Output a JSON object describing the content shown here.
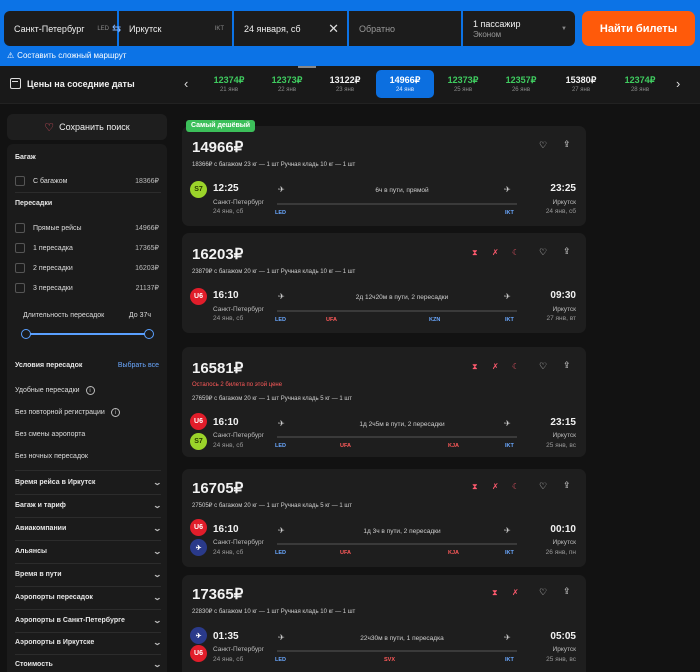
{
  "search": {
    "from": "Санкт-Петербург",
    "from_code": "LED",
    "to": "Иркутск",
    "to_code": "IKT",
    "date": "24 января, сб",
    "return_placeholder": "Обратно",
    "passengers": "1 пассажир",
    "cabin": "Эконом",
    "find_button": "Найти билеты",
    "complex_route": "Составить сложный маршрут"
  },
  "dates": {
    "title": "Цены на соседние даты",
    "cells": [
      {
        "price": "12374₽",
        "day": "21 янв",
        "style": "green"
      },
      {
        "price": "12373₽",
        "day": "22 янв",
        "style": "green"
      },
      {
        "price": "13122₽",
        "day": "23 янв",
        "style": "white"
      },
      {
        "price": "14966₽",
        "day": "24 янв",
        "style": "active"
      },
      {
        "price": "12373₽",
        "day": "25 янв",
        "style": "green"
      },
      {
        "price": "12357₽",
        "day": "26 янв",
        "style": "green"
      },
      {
        "price": "15380₽",
        "day": "27 янв",
        "style": "white"
      },
      {
        "price": "12374₽",
        "day": "28 янв",
        "style": "green"
      }
    ]
  },
  "sidebar": {
    "save_search": "Сохранить поиск",
    "baggage_title": "Багаж",
    "baggage_option": "С багажом",
    "baggage_value": "18366₽",
    "transfers_title": "Пересадки",
    "transfers": [
      {
        "label": "Прямые рейсы",
        "value": "14966₽"
      },
      {
        "label": "1 пересадка",
        "value": "17365₽"
      },
      {
        "label": "2 пересадки",
        "value": "16203₽"
      },
      {
        "label": "3 пересадки",
        "value": "21137₽"
      }
    ],
    "duration_label": "Длительность пересадок",
    "duration_value": "До 37ч",
    "conditions_title": "Условия пересадок",
    "select_all": "Выбрать все",
    "conditions": [
      "Удобные пересадки",
      "Без повторной регистрации",
      "Без смены аэропорта",
      "Без ночных пересадок"
    ],
    "accordions": [
      "Время рейса в Иркутск",
      "Багаж и тариф",
      "Авиакомпании",
      "Альянсы",
      "Время в пути",
      "Аэропорты пересадок",
      "Аэропорты в Санкт-Петербурге",
      "Аэропорты в Иркутске",
      "Стоимость"
    ]
  },
  "badge": "Самый дешёвый",
  "tickets": [
    {
      "price": "14966₽",
      "bag_line": "18366₽ с багажом 23 кг — 1 шт     Ручная кладь 10 кг — 1 шт",
      "dep_time": "12:25",
      "arr_time": "23:25",
      "dep_city": "Санкт-Петербург",
      "arr_city": "Иркутск",
      "dep_date": "24 янв, сб",
      "arr_date": "24 янв, сб",
      "duration": "6ч в пути, прямой",
      "airports": [
        "LED",
        "IKT"
      ]
    },
    {
      "price": "16203₽",
      "bag_line": "23879₽ с багажом 20 кг — 1 шт     Ручная кладь 10 кг — 1 шт",
      "dep_time": "16:10",
      "arr_time": "09:30",
      "dep_city": "Санкт-Петербург",
      "arr_city": "Иркутск",
      "dep_date": "24 янв, сб",
      "arr_date": "27 янв, вт",
      "duration": "2д 12ч20м в пути, 2 пересадки",
      "airports": [
        "LED",
        "UFA",
        "KZN",
        "IKT"
      ]
    },
    {
      "price": "16581₽",
      "warning": "Осталось 2 билета по этой цене",
      "bag_line": "27659₽ с багажом 20 кг — 1 шт     Ручная кладь 5 кг — 1 шт",
      "dep_time": "16:10",
      "arr_time": "23:15",
      "dep_city": "Санкт-Петербург",
      "arr_city": "Иркутск",
      "dep_date": "24 янв, сб",
      "arr_date": "25 янв, вс",
      "duration": "1д 2ч5м в пути, 2 пересадки",
      "airports": [
        "LED",
        "UFA",
        "KJA",
        "IKT"
      ]
    },
    {
      "price": "16705₽",
      "bag_line": "27505₽ с багажом 20 кг — 1 шт     Ручная кладь 5 кг — 1 шт",
      "dep_time": "16:10",
      "arr_time": "00:10",
      "dep_city": "Санкт-Петербург",
      "arr_city": "Иркутск",
      "dep_date": "24 янв, сб",
      "arr_date": "26 янв, пн",
      "duration": "1д 3ч в пути, 2 пересадки",
      "airports": [
        "LED",
        "UFA",
        "KJA",
        "IKT"
      ]
    },
    {
      "price": "17365₽",
      "bag_line": "22830₽ с багажом 10 кг — 1 шт     Ручная кладь 10 кг — 1 шт",
      "dep_time": "01:35",
      "arr_time": "05:05",
      "dep_city": "Санкт-Петербург",
      "arr_city": "Иркутск",
      "dep_date": "24 янв, сб",
      "arr_date": "25 янв, вс",
      "duration": "22ч30м в пути, 1 пересадка",
      "airports": [
        "LED",
        "SVX",
        "IKT"
      ]
    }
  ],
  "icons": {
    "heart": "heart-icon",
    "share": "share-icon",
    "hourglass": "hourglass-icon",
    "luggage": "luggage-warning-icon",
    "moon": "night-icon"
  },
  "colors": {
    "brand_blue": "#0c73e6",
    "cta_orange": "#ff5a0a",
    "green_price": "#3fcb5f",
    "badge_green": "#3cbf5a",
    "warning_red": "#ff5a5a"
  }
}
